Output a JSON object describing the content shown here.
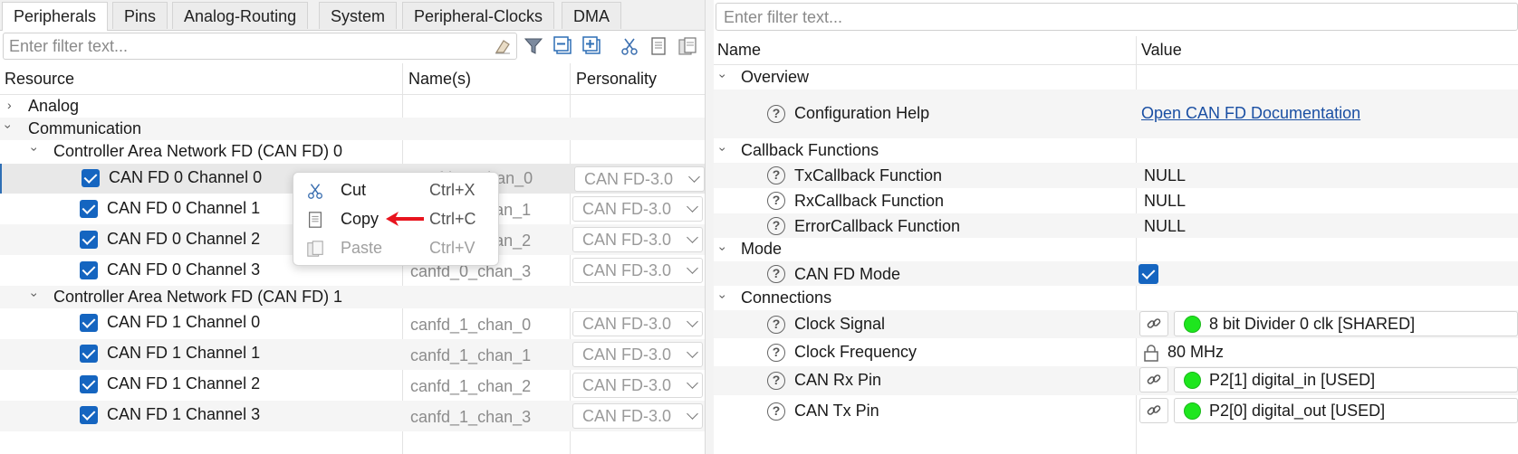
{
  "tabs": [
    "Peripherals",
    "Pins",
    "Analog-Routing",
    "System",
    "Peripheral-Clocks",
    "DMA"
  ],
  "left_filter": {
    "placeholder": "Enter filter text..."
  },
  "left_columns": {
    "resource": "Resource",
    "names": "Name(s)",
    "personality": "Personality"
  },
  "tree": {
    "analog": "Analog",
    "communication": "Communication",
    "group0": "Controller Area Network FD (CAN FD) 0",
    "group1": "Controller Area Network FD (CAN FD) 1",
    "g0_items": [
      {
        "label": "CAN FD 0 Channel 0",
        "name": "canfd_0_chan_0",
        "personality": "CAN FD-3.0"
      },
      {
        "label": "CAN FD 0 Channel 1",
        "name": "canfd_0_chan_1",
        "personality": "CAN FD-3.0"
      },
      {
        "label": "CAN FD 0 Channel 2",
        "name": "canfd_0_chan_2",
        "personality": "CAN FD-3.0"
      },
      {
        "label": "CAN FD 0 Channel 3",
        "name": "canfd_0_chan_3",
        "personality": "CAN FD-3.0"
      }
    ],
    "g1_items": [
      {
        "label": "CAN FD 1 Channel 0",
        "name": "canfd_1_chan_0",
        "personality": "CAN FD-3.0"
      },
      {
        "label": "CAN FD 1 Channel 1",
        "name": "canfd_1_chan_1",
        "personality": "CAN FD-3.0"
      },
      {
        "label": "CAN FD 1 Channel 2",
        "name": "canfd_1_chan_2",
        "personality": "CAN FD-3.0"
      },
      {
        "label": "CAN FD 1 Channel 3",
        "name": "canfd_1_chan_3",
        "personality": "CAN FD-3.0"
      }
    ]
  },
  "context_menu": {
    "cut": {
      "label": "Cut",
      "shortcut": "Ctrl+X"
    },
    "copy": {
      "label": "Copy",
      "shortcut": "Ctrl+C"
    },
    "paste": {
      "label": "Paste",
      "shortcut": "Ctrl+V"
    }
  },
  "right_filter": {
    "placeholder": "Enter filter text..."
  },
  "right_columns": {
    "name": "Name",
    "value": "Value"
  },
  "params": {
    "overview": "Overview",
    "config_help": "Configuration Help",
    "config_help_link": "Open CAN FD Documentation",
    "callbacks": "Callback Functions",
    "tx_cb": "TxCallback Function",
    "tx_cb_val": "NULL",
    "rx_cb": "RxCallback Function",
    "rx_cb_val": "NULL",
    "err_cb": "ErrorCallback Function",
    "err_cb_val": "NULL",
    "mode": "Mode",
    "canfd_mode": "CAN FD Mode",
    "canfd_mode_checked": true,
    "connections": "Connections",
    "clock_signal": "Clock Signal",
    "clock_signal_val": "8 bit Divider 0 clk [SHARED]",
    "clock_freq": "Clock Frequency",
    "clock_freq_val": "80 MHz",
    "rx_pin": "CAN Rx Pin",
    "rx_pin_val": "P2[1] digital_in [USED]",
    "tx_pin": "CAN Tx Pin",
    "tx_pin_val": "P2[0] digital_out [USED]"
  },
  "colors": {
    "accent": "#1565c0",
    "status_ok": "#1ee61e",
    "link": "#1a4fa3",
    "arrow": "#e8141e"
  }
}
